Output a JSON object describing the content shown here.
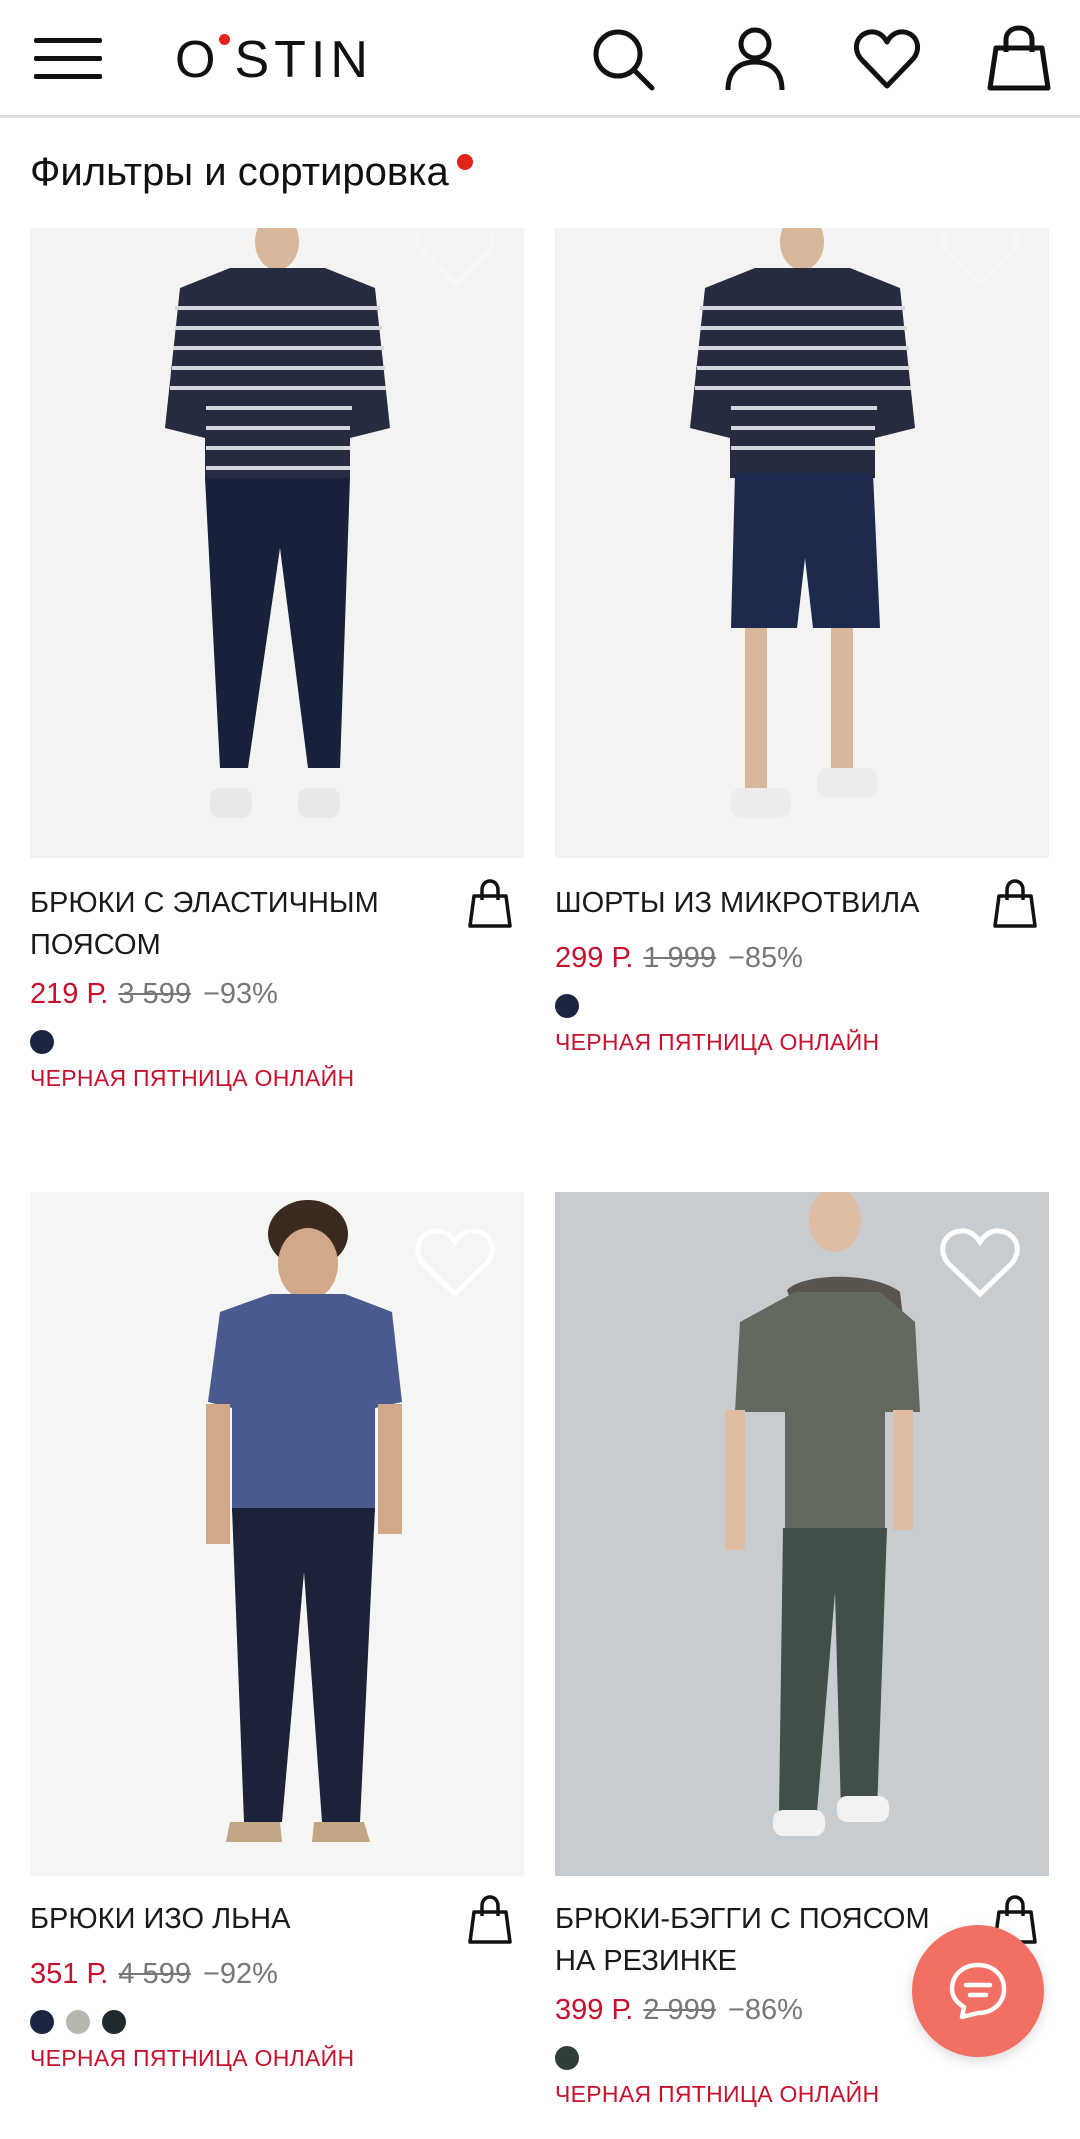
{
  "header": {
    "logo": "O'STIN",
    "logo_text": "O STIN",
    "icons": [
      "menu-icon",
      "search-icon",
      "account-icon",
      "favorites-icon",
      "cart-icon"
    ]
  },
  "filters": {
    "label": "Фильтры и сортировка",
    "indicator_color": "#e2231a"
  },
  "products": [
    {
      "title": "БРЮКИ С ЭЛАСТИЧНЫМ ПОЯСОМ",
      "price": "219 Р.",
      "old_price": "3 599",
      "discount": "−93%",
      "swatches": [
        "#1b2540"
      ],
      "promo": "ЧЕРНАЯ ПЯТНИЦА ОНЛАЙН"
    },
    {
      "title": "ШОРТЫ ИЗ МИКРОТВИЛА",
      "price": "299 Р.",
      "old_price": "1 999",
      "discount": "−85%",
      "swatches": [
        "#1b2540"
      ],
      "promo": "ЧЕРНАЯ ПЯТНИЦА ОНЛАЙН"
    },
    {
      "title": "БРЮКИ ИЗО ЛЬНА",
      "price": "351 Р.",
      "old_price": "4 599",
      "discount": "−92%",
      "swatches": [
        "#1b2540",
        "#b8b7ad",
        "#1e2a2e"
      ],
      "promo": "ЧЕРНАЯ ПЯТНИЦА ОНЛАЙН"
    },
    {
      "title": "БРЮКИ-БЭГГИ С ПОЯСОМ НА РЕЗИНКЕ",
      "price": "399 Р.",
      "old_price": "2 999",
      "discount": "−86%",
      "swatches": [
        "#2f3e3a"
      ],
      "promo": "ЧЕРНАЯ ПЯТНИЦА ОНЛАЙН"
    }
  ],
  "colors": {
    "price": "#c8102e",
    "chat_button": "#f26f63",
    "accent_dot": "#e2231a"
  }
}
